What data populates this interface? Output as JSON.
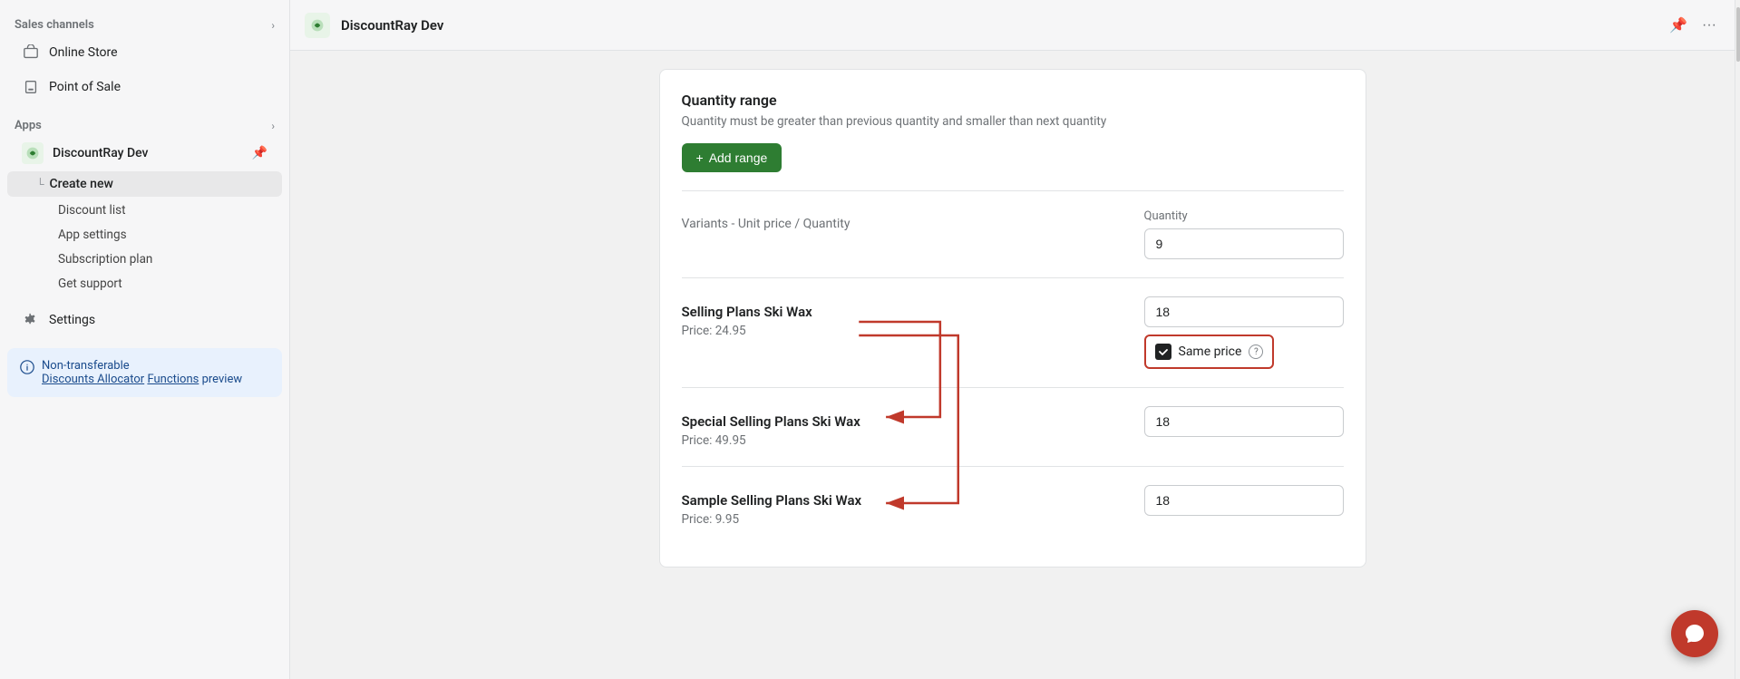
{
  "sidebar": {
    "sales_channels_title": "Sales channels",
    "online_store_label": "Online Store",
    "point_of_sale_label": "Point of Sale",
    "apps_title": "Apps",
    "apps_chevron": "›",
    "discountray_name": "DiscountRay Dev",
    "create_new_label": "Create new",
    "discount_list_label": "Discount list",
    "app_settings_label": "App settings",
    "subscription_plan_label": "Subscription plan",
    "get_support_label": "Get support",
    "settings_label": "Settings",
    "info_text_line1": "Non-transferable",
    "info_text_link1": "Discounts Allocator",
    "info_text_link2": "Functions",
    "info_text_line2": "preview"
  },
  "topbar": {
    "app_name": "DiscountRay Dev",
    "pin_tooltip": "Pin",
    "more_tooltip": "More"
  },
  "content": {
    "quantity_range_title": "Quantity range",
    "quantity_range_description": "Quantity must be greater than previous quantity and smaller than next quantity",
    "add_range_label": "+ Add range",
    "variants_label": "Variants - Unit price / Quantity",
    "quantity_col_label": "Quantity",
    "quantity_value_1": "9",
    "selling_plans_name": "Selling Plans Ski Wax",
    "selling_plans_price": "Price: 24.95",
    "selling_plans_qty": "18",
    "same_price_label": "Same price",
    "special_selling_plans_name": "Special Selling Plans Ski Wax",
    "special_selling_plans_price": "Price: 49.95",
    "special_selling_plans_qty": "18",
    "sample_selling_plans_name": "Sample Selling Plans Ski Wax",
    "sample_selling_plans_price": "Price: 9.95",
    "sample_selling_plans_qty": "18"
  },
  "colors": {
    "add_range_bg": "#2e7d32",
    "checkbox_border": "#c0392b",
    "arrow_color": "#c0392b",
    "chat_btn_bg": "#c0392b"
  }
}
